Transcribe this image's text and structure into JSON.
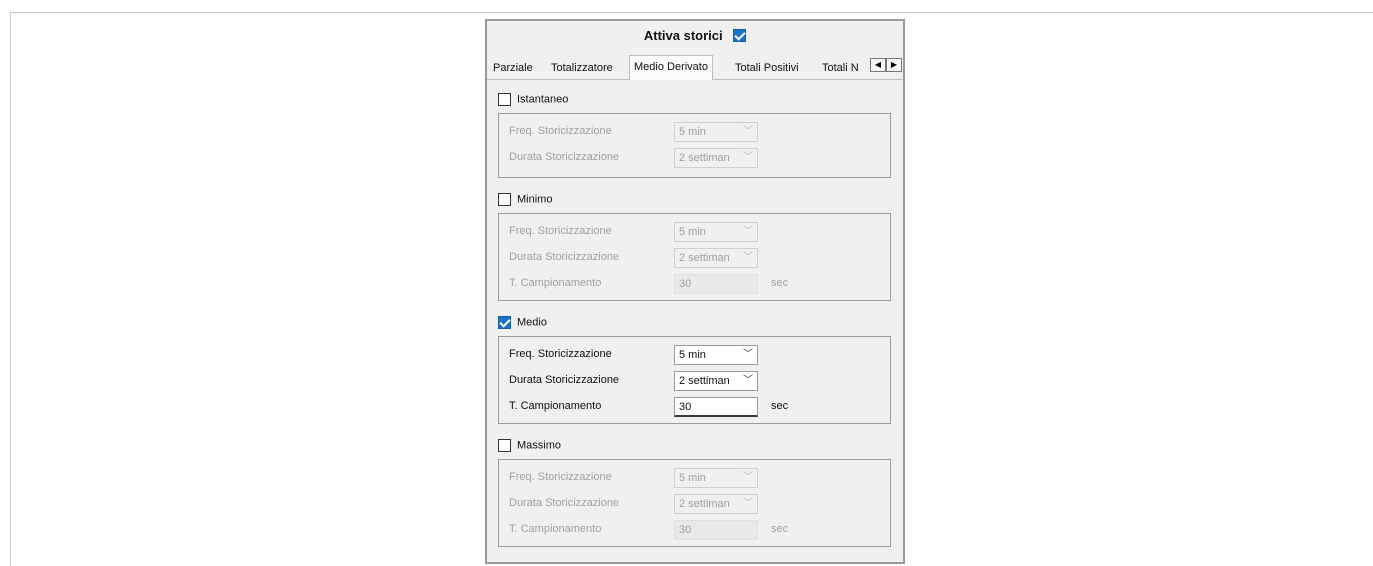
{
  "header": {
    "title": "Attiva storici",
    "checked": true
  },
  "tabs": [
    {
      "label": "Parziale",
      "active": false
    },
    {
      "label": "Totalizzatore",
      "active": false
    },
    {
      "label": "Medio Derivato",
      "active": true
    },
    {
      "label": "Totali Positivi",
      "active": false
    },
    {
      "label": "Totali N",
      "active": false
    }
  ],
  "sections": {
    "istantaneo": {
      "label": "Istantaneo",
      "checked": false,
      "freq_label": "Freq. Storicizzazione",
      "freq_value": "5 min",
      "durata_label": "Durata Storicizzazione",
      "durata_value": "2 settiman"
    },
    "minimo": {
      "label": "Minimo",
      "checked": false,
      "freq_label": "Freq. Storicizzazione",
      "freq_value": "5 min",
      "durata_label": "Durata Storicizzazione",
      "durata_value": "2 settiman",
      "camp_label": "T. Campionamento",
      "camp_value": "30",
      "camp_unit": "sec"
    },
    "medio": {
      "label": "Medio",
      "checked": true,
      "freq_label": "Freq. Storicizzazione",
      "freq_value": "5 min",
      "durata_label": "Durata Storicizzazione",
      "durata_value": "2 settiman",
      "camp_label": "T. Campionamento",
      "camp_value": "30",
      "camp_unit": "sec"
    },
    "massimo": {
      "label": "Massimo",
      "checked": false,
      "freq_label": "Freq. Storicizzazione",
      "freq_value": "5 min",
      "durata_label": "Durata Storicizzazione",
      "durata_value": "2 settiman",
      "camp_label": "T. Campionamento",
      "camp_value": "30",
      "camp_unit": "sec"
    }
  },
  "icons": {
    "dropdown": "chevron-down-icon",
    "scroll_left": "arrow-left-icon",
    "scroll_right": "arrow-right-icon",
    "check": "check-icon"
  },
  "colors": {
    "check_accent": "#1a73c9",
    "disabled_text": "#a0a0a0"
  }
}
